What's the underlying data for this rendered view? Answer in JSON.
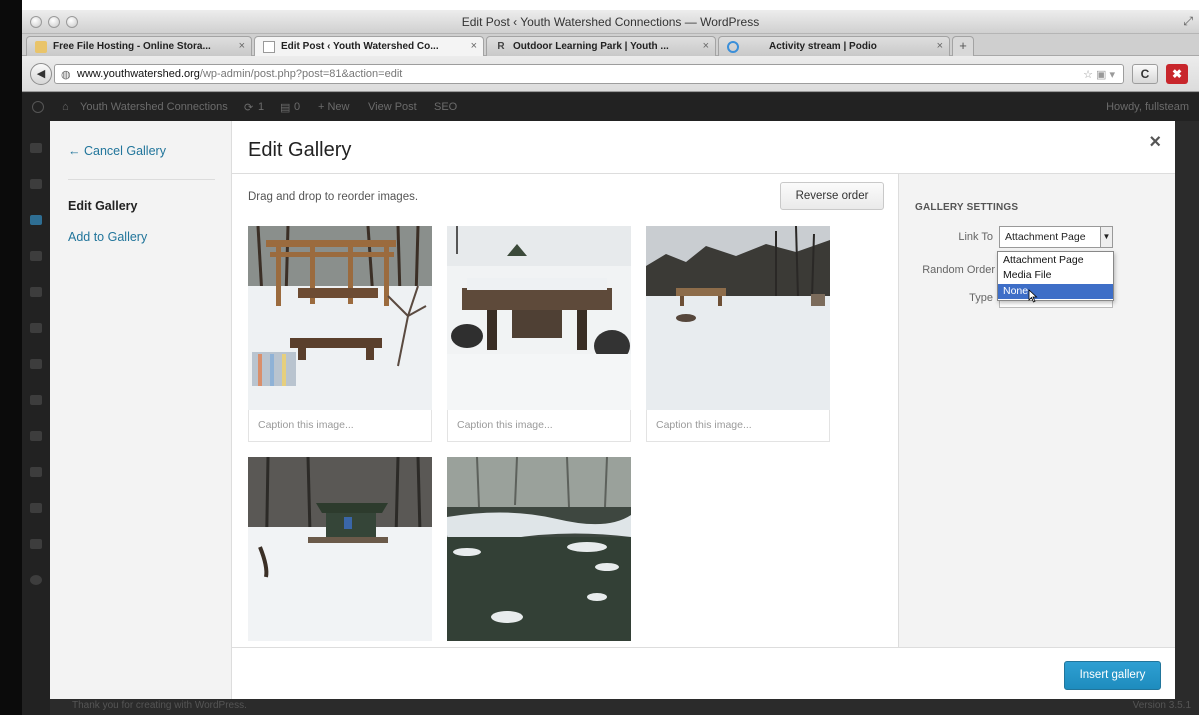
{
  "browser": {
    "window_title": "Edit Post ‹ Youth Watershed Connections — WordPress",
    "tabs": [
      {
        "label": "Free File Hosting - Online Stora...",
        "favicon": "page-icon"
      },
      {
        "label": "Edit Post ‹ Youth Watershed Co...",
        "favicon": "blank-page-icon"
      },
      {
        "label": "Outdoor Learning Park | Youth ...",
        "favicon": "r-logo-icon"
      },
      {
        "label": "Activity stream | Podio",
        "favicon": "podio-icon"
      }
    ],
    "tab_close": "×",
    "new_tab": "+",
    "url_host": "www.youthwatershed.org",
    "url_path": "/wp-admin/post.php?post=81&action=edit",
    "url_right_icons": "☆ ▣ ▾",
    "reload": "C",
    "addon": "✖"
  },
  "adminbar": {
    "site_name": "Youth Watershed Connections",
    "updates": "1",
    "comments": "0",
    "new": "+ New",
    "view_post": "View Post",
    "seo": "SEO",
    "howdy": "Howdy, fullsteam"
  },
  "footer": {
    "thanks": "Thank you for creating with WordPress.",
    "version": "Version 3.5.1"
  },
  "modal": {
    "menu": {
      "cancel": "← Cancel Gallery",
      "edit": "Edit Gallery",
      "add": "Add to Gallery"
    },
    "title": "Edit Gallery",
    "close": "×",
    "drag_hint": "Drag and drop to reorder images.",
    "reverse_order": "Reverse order",
    "caption_placeholder": "Caption this image...",
    "images": [
      {
        "scene": "snowy-pergola-benches",
        "has_caption": true
      },
      {
        "scene": "snowy-wooden-bridge",
        "has_caption": true
      },
      {
        "scene": "snowy-field-treeline",
        "has_caption": true
      },
      {
        "scene": "snowy-shelter-woods",
        "has_caption": false
      },
      {
        "scene": "winter-creek",
        "has_caption": false
      }
    ],
    "settings": {
      "title": "GALLERY SETTINGS",
      "link_to_label": "Link To",
      "link_to_value": "Attachment Page",
      "link_options": [
        "Attachment Page",
        "Media File",
        "None"
      ],
      "selected_option": "None",
      "random_order_label": "Random Order",
      "type_label": "Type"
    },
    "insert_gallery": "Insert gallery"
  },
  "colors": {
    "link": "#21759b",
    "primary_button": "#1e8cbe",
    "dropdown_highlight": "#3e6ec7",
    "admin_bar": "#222222"
  }
}
